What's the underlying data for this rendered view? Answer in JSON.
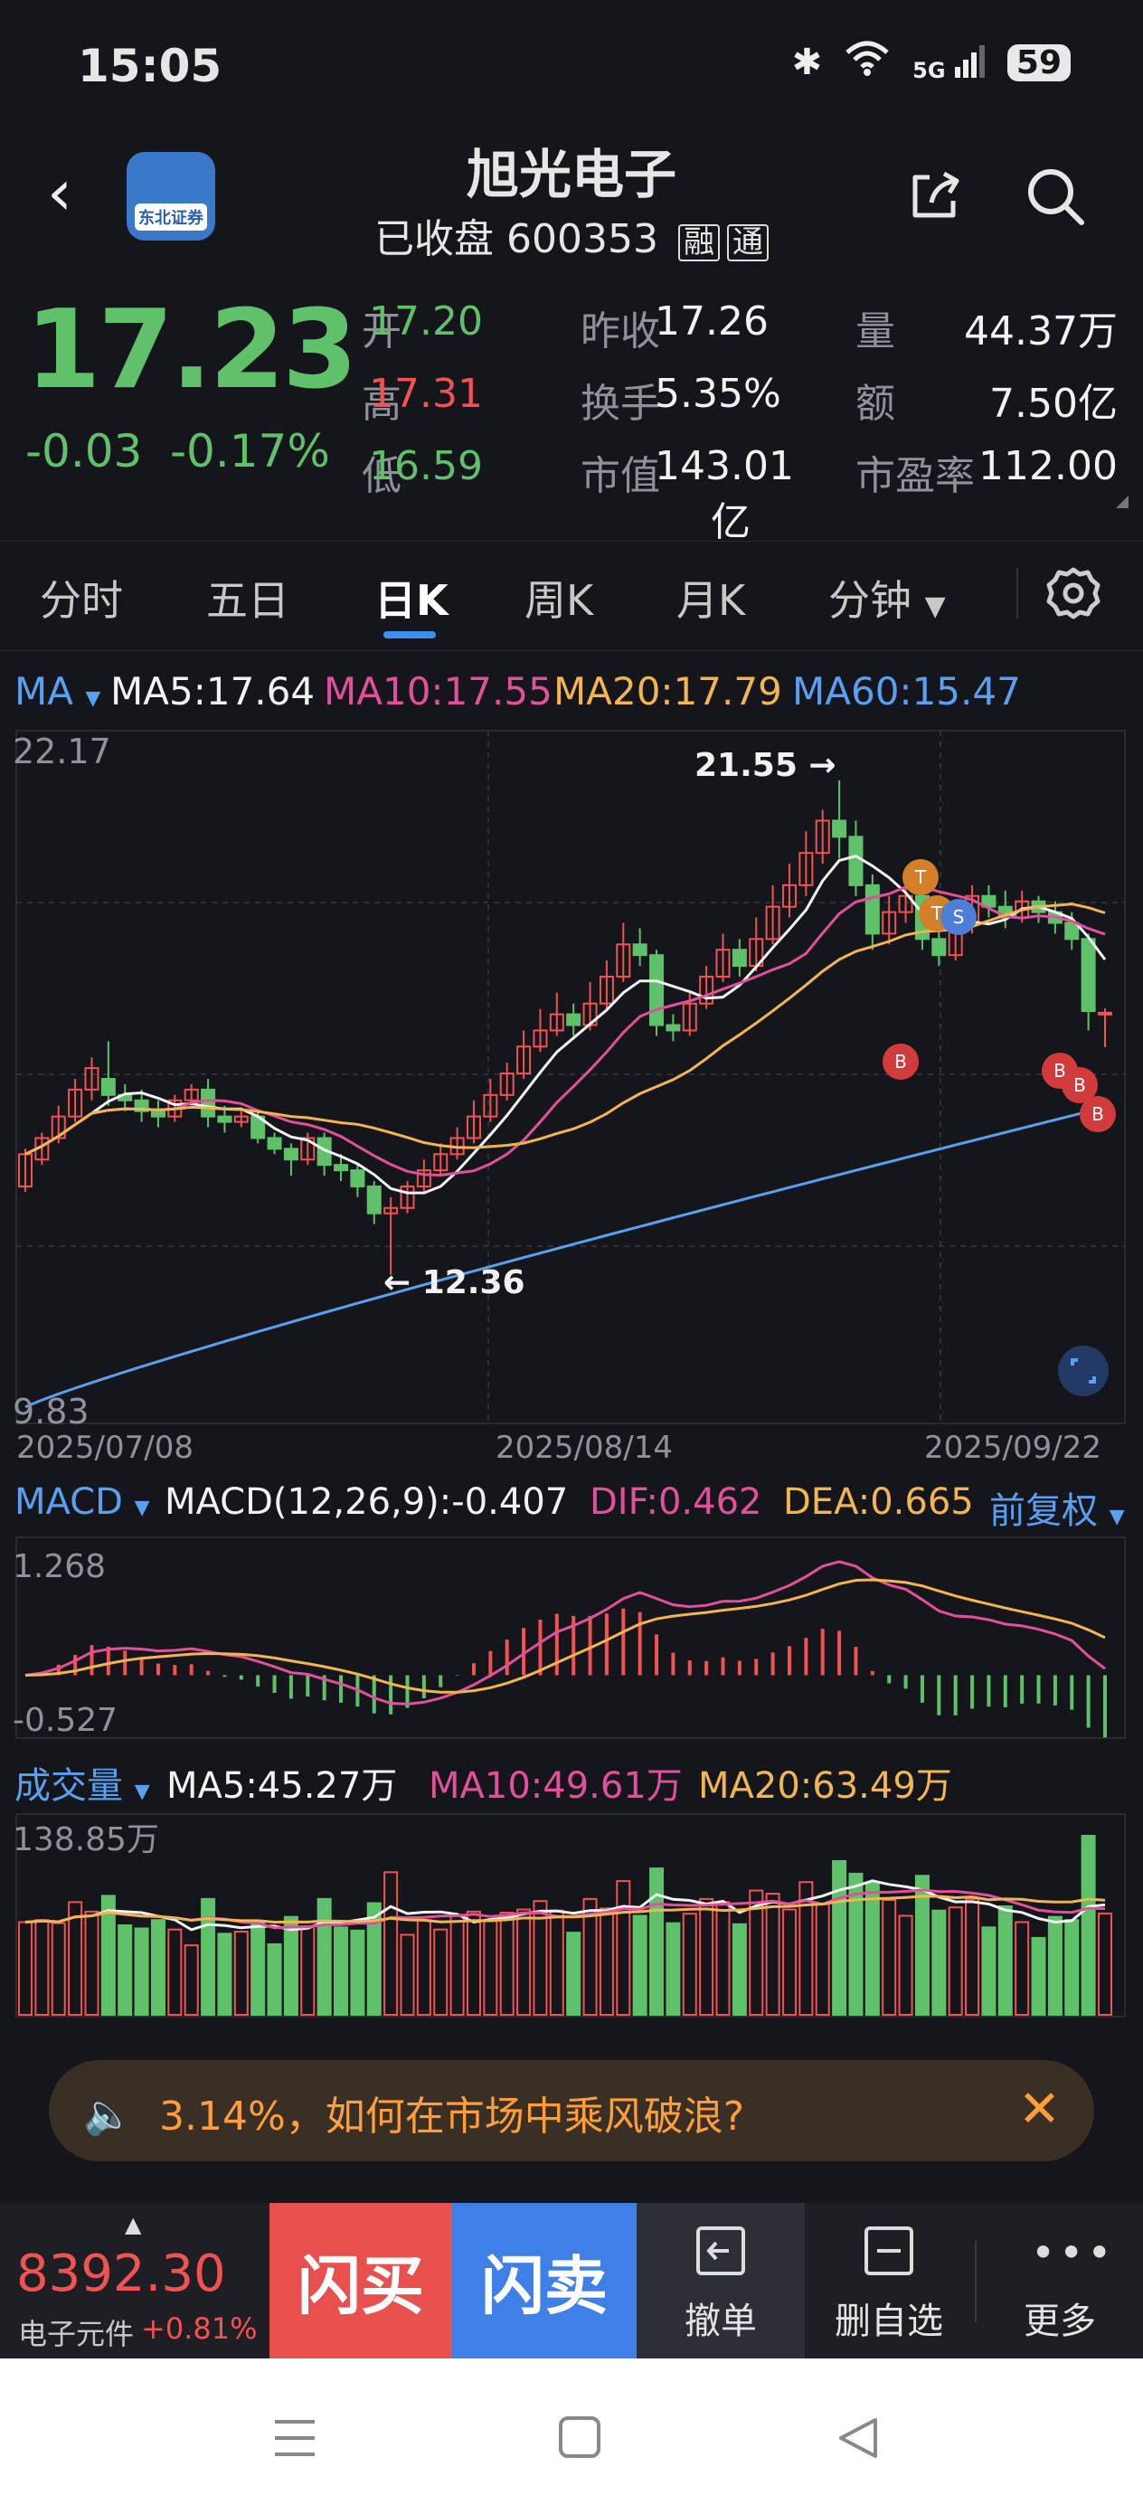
{
  "status_bar": {
    "time": "15:05",
    "network": "5G",
    "battery": "59"
  },
  "header": {
    "name": "旭光电子",
    "status": "已收盘",
    "code": "600353",
    "tag_margin": "融",
    "tag_connect": "通"
  },
  "quote": {
    "price": "17.23",
    "change": "-0.03",
    "change_pct": "-0.17%",
    "rows": [
      {
        "l1": "开",
        "v1": "17.20",
        "l2": "昨收",
        "v2": "17.26",
        "l3": "量",
        "v3": "44.37万"
      },
      {
        "l1": "高",
        "v1": "17.31",
        "l2": "换手",
        "v2": "5.35%",
        "l3": "额",
        "v3": "7.50亿"
      },
      {
        "l1": "低",
        "v1": "16.59",
        "l2": "市值",
        "v2": "143.01亿",
        "l3": "市盈率",
        "v3": "112.00"
      }
    ],
    "v1_colors": [
      "#5fc16a",
      "#f25252",
      "#5fc16a"
    ]
  },
  "tabs": [
    "分时",
    "五日",
    "日K",
    "周K",
    "月K",
    "分钟"
  ],
  "active_tab": "日K",
  "ma_legend": {
    "label": "MA",
    "ma5": "MA5:17.64",
    "ma10": "MA10:17.55",
    "ma20": "MA20:17.79",
    "ma60": "MA60:15.47"
  },
  "chart_labels": {
    "price_high": "22.17",
    "price_low": "9.83",
    "peak": "21.55 →",
    "trough": "← 12.36",
    "dates": [
      "2025/07/08",
      "2025/08/14",
      "2025/09/22"
    ]
  },
  "macd_legend": {
    "label": "MACD",
    "macd": "MACD(12,26,9):-0.407",
    "dif": "DIF:0.462",
    "dea": "DEA:0.665",
    "adjust": "前复权",
    "top": "1.268",
    "bottom": "-0.527"
  },
  "volume_legend": {
    "label": "成交量",
    "ma5": "MA5:45.27万",
    "ma10": "MA10:49.61万",
    "ma20": "MA20:63.49万",
    "top": "138.85万"
  },
  "colors": {
    "up": "#f25252",
    "down": "#5fc16a",
    "ma5": "#f2f2f2",
    "ma10": "#e2509b",
    "ma20": "#f2b550",
    "ma60": "#5aa0f0"
  },
  "banner": {
    "text": "3.14%，如何在市场中乘风破浪?"
  },
  "toolbar": {
    "index_value": "8392.30",
    "index_name": "电子元件",
    "index_change": "+0.81%",
    "buy": "闪买",
    "sell": "闪卖",
    "cancel": "撤单",
    "delete_fav": "删自选",
    "more": "更多"
  },
  "chart_data": {
    "type": "candlestick",
    "dates": [
      "2025/07/08",
      "2025/08/14",
      "2025/09/22"
    ],
    "price_range": [
      9.83,
      22.17
    ],
    "annotated_high": 21.55,
    "annotated_low": 12.36,
    "ma_latest": {
      "MA5": 17.64,
      "MA10": 17.55,
      "MA20": 17.79,
      "MA60": 15.47
    },
    "candles": [
      [
        14.0,
        14.6,
        13.9,
        14.7
      ],
      [
        14.5,
        14.9,
        14.4,
        15.0
      ],
      [
        14.9,
        15.3,
        14.8,
        15.5
      ],
      [
        15.3,
        15.8,
        15.2,
        16.0
      ],
      [
        15.8,
        16.2,
        15.6,
        16.4
      ],
      [
        16.0,
        15.7,
        15.5,
        16.7
      ],
      [
        15.7,
        15.6,
        15.4,
        15.9
      ],
      [
        15.6,
        15.4,
        15.2,
        15.8
      ],
      [
        15.4,
        15.3,
        15.1,
        15.6
      ],
      [
        15.3,
        15.6,
        15.2,
        15.7
      ],
      [
        15.6,
        15.8,
        15.5,
        15.9
      ],
      [
        15.8,
        15.3,
        15.1,
        16.0
      ],
      [
        15.3,
        15.2,
        15.0,
        15.5
      ],
      [
        15.2,
        15.3,
        15.1,
        15.4
      ],
      [
        15.3,
        14.9,
        14.8,
        15.4
      ],
      [
        14.9,
        14.7,
        14.6,
        15.0
      ],
      [
        14.7,
        14.5,
        14.2,
        14.8
      ],
      [
        14.5,
        14.9,
        14.4,
        15.0
      ],
      [
        14.9,
        14.4,
        14.2,
        15.0
      ],
      [
        14.4,
        14.3,
        14.1,
        14.6
      ],
      [
        14.3,
        14.0,
        13.8,
        14.4
      ],
      [
        14.0,
        13.5,
        13.3,
        14.1
      ],
      [
        13.5,
        13.6,
        12.36,
        13.8
      ],
      [
        13.6,
        14.0,
        13.5,
        14.1
      ],
      [
        14.0,
        14.3,
        13.9,
        14.5
      ],
      [
        14.3,
        14.6,
        14.2,
        14.8
      ],
      [
        14.6,
        14.9,
        14.5,
        15.1
      ],
      [
        14.9,
        15.3,
        14.8,
        15.6
      ],
      [
        15.3,
        15.7,
        15.2,
        16.0
      ],
      [
        15.7,
        16.1,
        15.6,
        16.3
      ],
      [
        16.1,
        16.6,
        16.0,
        16.9
      ],
      [
        16.6,
        16.9,
        16.5,
        17.3
      ],
      [
        16.9,
        17.2,
        16.8,
        17.6
      ],
      [
        17.2,
        17.0,
        16.8,
        17.4
      ],
      [
        17.0,
        17.4,
        16.9,
        17.8
      ],
      [
        17.4,
        17.9,
        17.3,
        18.2
      ],
      [
        17.9,
        18.5,
        17.8,
        18.9
      ],
      [
        18.5,
        18.3,
        18.1,
        18.8
      ],
      [
        18.3,
        17.0,
        16.8,
        18.4
      ],
      [
        17.0,
        16.9,
        16.7,
        17.2
      ],
      [
        16.9,
        17.4,
        16.8,
        17.6
      ],
      [
        17.4,
        17.9,
        17.3,
        18.1
      ],
      [
        17.9,
        18.4,
        17.8,
        18.7
      ],
      [
        18.4,
        18.1,
        17.9,
        18.6
      ],
      [
        18.1,
        18.6,
        18.0,
        19.0
      ],
      [
        18.6,
        19.2,
        18.5,
        19.6
      ],
      [
        19.2,
        19.6,
        19.0,
        20.0
      ],
      [
        19.6,
        20.2,
        19.4,
        20.6
      ],
      [
        20.2,
        20.8,
        20.0,
        21.0
      ],
      [
        20.8,
        20.5,
        20.1,
        21.55
      ],
      [
        20.5,
        19.6,
        19.4,
        20.8
      ],
      [
        19.6,
        18.7,
        18.4,
        19.8
      ],
      [
        18.7,
        19.1,
        18.5,
        19.4
      ],
      [
        19.1,
        19.4,
        18.9,
        19.7
      ],
      [
        19.4,
        18.6,
        18.4,
        19.6
      ],
      [
        18.6,
        18.3,
        18.1,
        18.9
      ],
      [
        18.3,
        18.9,
        18.2,
        19.2
      ],
      [
        18.9,
        19.4,
        18.7,
        19.6
      ],
      [
        19.4,
        19.2,
        19.0,
        19.6
      ],
      [
        19.2,
        19.0,
        18.8,
        19.5
      ],
      [
        19.0,
        19.3,
        18.9,
        19.5
      ],
      [
        19.3,
        19.1,
        18.9,
        19.4
      ],
      [
        19.1,
        18.9,
        18.7,
        19.3
      ],
      [
        18.9,
        18.6,
        18.4,
        19.1
      ],
      [
        18.6,
        17.26,
        16.9,
        18.7
      ],
      [
        17.2,
        17.23,
        16.59,
        17.31
      ]
    ],
    "volume_range_max": "138.85万",
    "macd_range": [
      -0.527,
      1.268
    ],
    "macd_latest": {
      "MACD": -0.407,
      "DIF": 0.462,
      "DEA": 0.665
    }
  }
}
